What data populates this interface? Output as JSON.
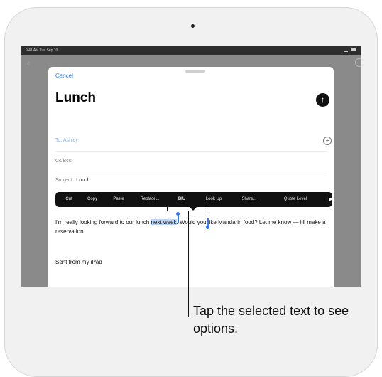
{
  "status_bar": {
    "left": "9:41 AM  Tue Sep 10",
    "right": "100%"
  },
  "compose": {
    "cancel_label": "Cancel",
    "subject_title": "Lunch",
    "to_label": "To:",
    "to_value": "Ashley",
    "cc_label": "Cc/Bcc:",
    "subject_label": "Subject:",
    "subject_value": "Lunch",
    "body_before": "I'm really looking forward to our lunch ",
    "body_selected": "next week",
    "body_after": ". Would you like Mandarin food? Let me know — I'll make a reservation.",
    "signature": "Sent from my iPad"
  },
  "edit_menu": {
    "items": [
      "Cut",
      "Copy",
      "Paste",
      "Replace...",
      "BIU",
      "Look Up",
      "Share...",
      "Quote Level"
    ],
    "more_icon": "chevron-right"
  },
  "callout": {
    "text": "Tap the selected text to see options."
  }
}
